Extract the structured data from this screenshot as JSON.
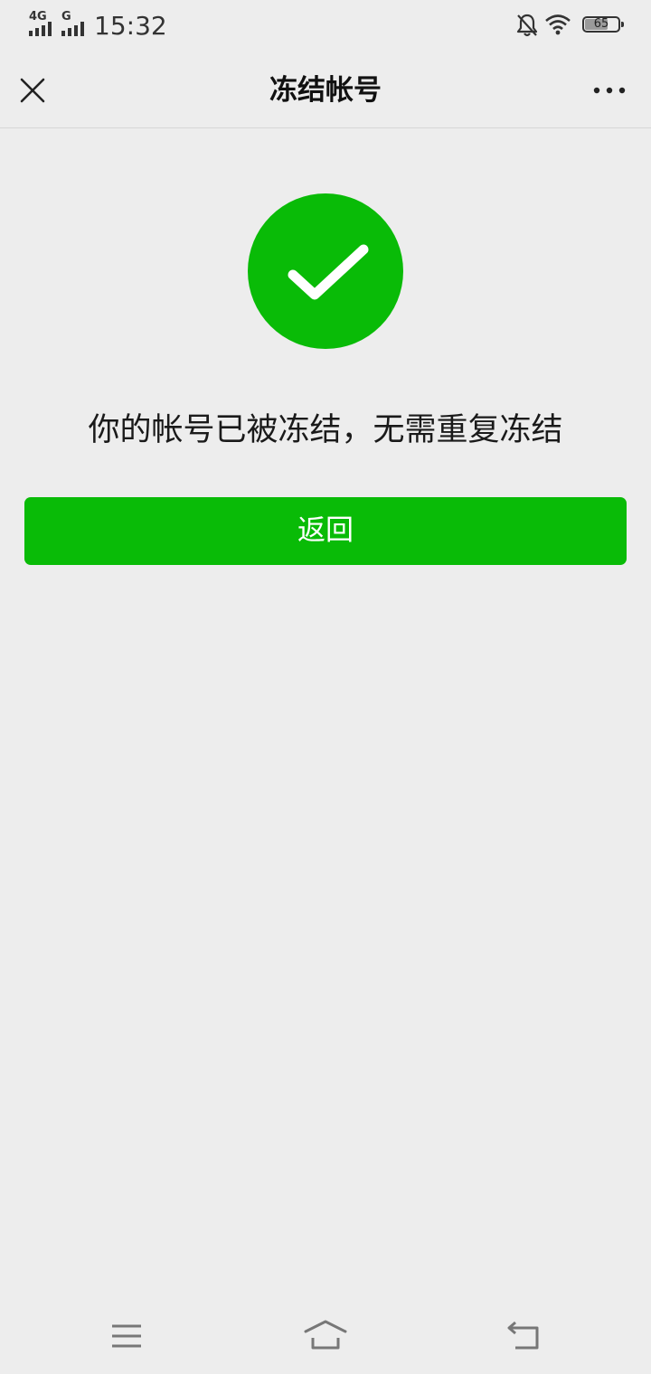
{
  "status_bar": {
    "network_1": "4G",
    "network_2": "G",
    "time": "15:32",
    "battery_level": "65",
    "battery_fraction": 0.65,
    "icons": [
      "mute-bell-icon",
      "wifi-icon",
      "battery-icon"
    ]
  },
  "nav": {
    "title": "冻结帐号",
    "close_icon": "close-icon",
    "more_icon": "more-icon"
  },
  "main": {
    "icon": "success-check-icon",
    "message": "你的帐号已被冻结，无需重复冻结",
    "back_label": "返回"
  },
  "system_nav": {
    "icons": [
      "menu-icon",
      "home-icon",
      "back-icon"
    ]
  },
  "colors": {
    "background": "#ededed",
    "accent_green": "#09bb07",
    "text": "#1a1a1a"
  }
}
